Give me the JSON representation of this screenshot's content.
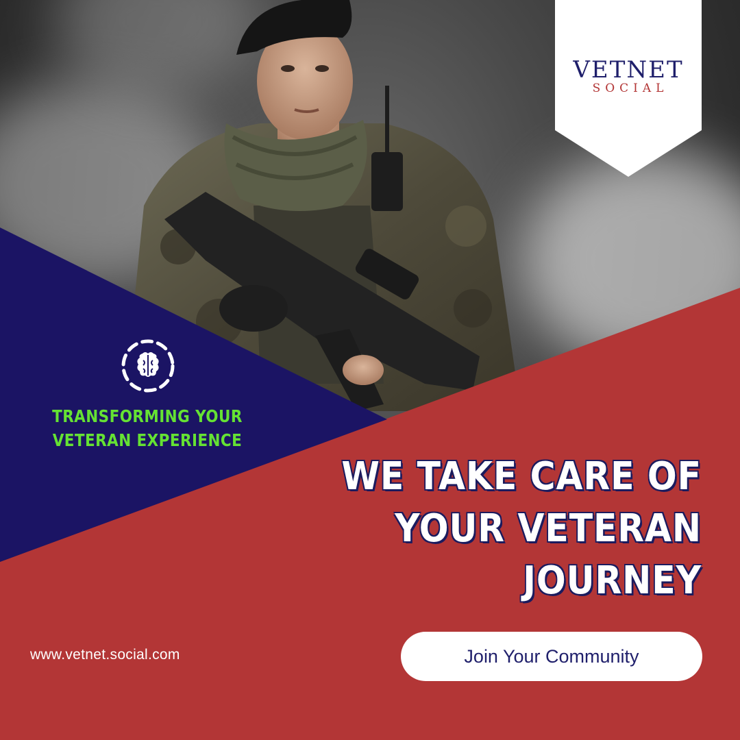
{
  "brand": {
    "logo_main": "VETNET",
    "logo_sub": "SOCIAL"
  },
  "tagline": {
    "line1": "TRANSFORMING YOUR",
    "line2": "VETERAN EXPERIENCE"
  },
  "headline": {
    "line1": "WE TAKE CARE OF",
    "line2": "YOUR VETERAN",
    "line3": "JOURNEY"
  },
  "website": "www.vetnet.social.com",
  "cta": {
    "label": "Join Your Community"
  },
  "icons": {
    "feature": "brain-icon",
    "photo": "soldier-photo"
  },
  "colors": {
    "navy": "#1b1464",
    "red": "#b33636",
    "green": "#65e233",
    "white": "#ffffff"
  }
}
